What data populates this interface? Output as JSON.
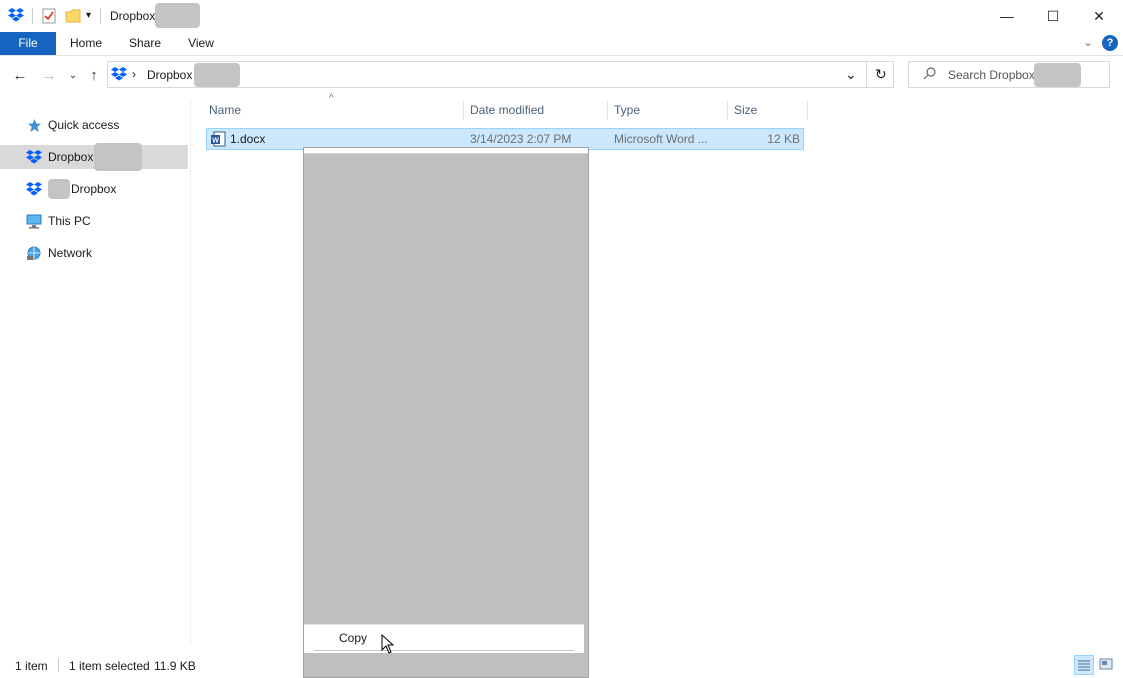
{
  "window": {
    "title": "Dropbox",
    "controls": {
      "minimize": "—",
      "maximize": "☐",
      "close": "✕"
    }
  },
  "ribbon": {
    "tabs": [
      {
        "label": "File"
      },
      {
        "label": "Home"
      },
      {
        "label": "Share"
      },
      {
        "label": "View"
      }
    ],
    "help": "?"
  },
  "address": {
    "crumb_separator": "›",
    "crumb": "Dropbox",
    "refresh": "↻"
  },
  "search": {
    "placeholder": "Search Dropbox"
  },
  "nav": {
    "items": [
      {
        "label": "Quick access"
      },
      {
        "label": "Dropbox"
      },
      {
        "label": "Dropbox"
      },
      {
        "label": "This PC"
      },
      {
        "label": "Network"
      }
    ]
  },
  "columns": {
    "name": "Name",
    "date": "Date modified",
    "type": "Type",
    "size": "Size"
  },
  "files": [
    {
      "name": "1.docx",
      "date": "3/14/2023 2:07 PM",
      "type": "Microsoft Word ...",
      "size": "12 KB"
    }
  ],
  "context_menu": {
    "copy": "Copy"
  },
  "status": {
    "count": "1 item",
    "selected": "1 item selected",
    "size": "11.9 KB"
  },
  "colors": {
    "accent": "#1565c0",
    "selection": "#cce8ff",
    "dropbox": "#0061fe"
  }
}
